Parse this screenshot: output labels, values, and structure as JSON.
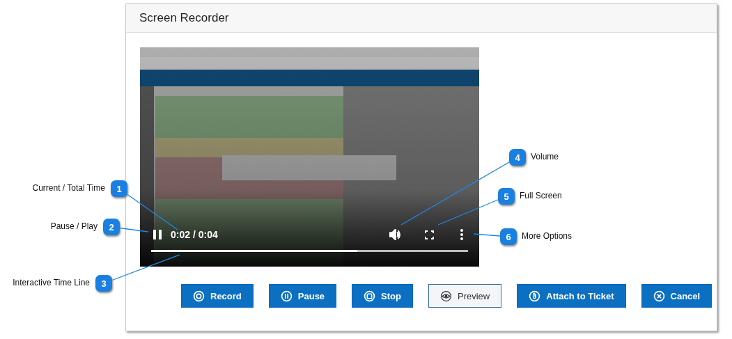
{
  "dialog": {
    "title": "Screen Recorder"
  },
  "player": {
    "playing": true,
    "time": "0:02 / 0:04",
    "level": 0.65
  },
  "buttons": [
    {
      "label": "Record",
      "kind": "record",
      "primary": true
    },
    {
      "label": "Pause",
      "kind": "pause",
      "primary": true
    },
    {
      "label": "Stop",
      "kind": "stop",
      "primary": true
    },
    {
      "label": "Preview",
      "kind": "preview",
      "primary": false
    },
    {
      "label": "Attach to Ticket",
      "kind": "attach",
      "primary": true
    },
    {
      "label": "Cancel",
      "kind": "cancel",
      "primary": true
    }
  ],
  "callouts": [
    {
      "number": "1",
      "label": "Current / Total Time"
    },
    {
      "number": "2",
      "label": "Pause / Play"
    },
    {
      "number": "3",
      "label": "Interactive Time Line"
    },
    {
      "number": "4",
      "label": "Volume"
    },
    {
      "number": "5",
      "label": "Full Screen"
    },
    {
      "number": "6",
      "label": "More Options"
    }
  ]
}
